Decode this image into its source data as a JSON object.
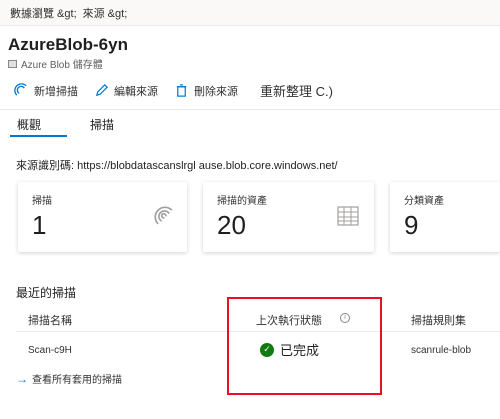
{
  "breadcrumb": {
    "item1": "數據瀏覽 &gt;",
    "item2": "來源 &gt;"
  },
  "header": {
    "title": "AzureBlob-6yn",
    "subtitle": "Azure Blob 儲存體"
  },
  "toolbar": {
    "new_scan": "新增掃描",
    "edit_source": "編輯來源",
    "delete_source": "刪除來源",
    "refresh": "重新整理 C.)"
  },
  "tabs": [
    {
      "label": "概觀"
    },
    {
      "label": "掃描"
    }
  ],
  "source": {
    "line": "來源識別碼: https://blobdatascanslrgl ause.blob.core.windows.net/"
  },
  "cards": [
    {
      "label": "掃描",
      "value": "1",
      "icon": "scan-icon"
    },
    {
      "label": "掃描的資產",
      "value": "20",
      "icon": "table-icon"
    },
    {
      "label": "分類資產",
      "value": "9"
    }
  ],
  "recent": {
    "title": "最近的掃描",
    "col_name": "掃描名稱",
    "col_status": "上次執行狀態",
    "col_rule": "掃描規則集",
    "row": {
      "name": "Scan-c9H",
      "status": "已完成",
      "rule": "scanrule-blob"
    },
    "view_all": "查看所有套用的掃描"
  },
  "colors": {
    "accent": "#0078d4",
    "success": "#107c10",
    "highlight": "#e81123"
  }
}
